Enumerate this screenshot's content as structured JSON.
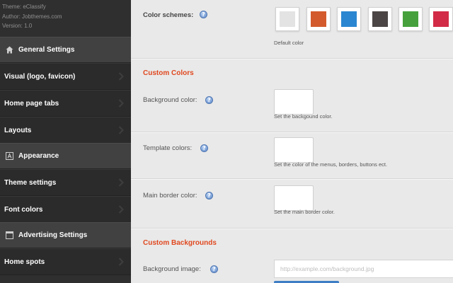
{
  "sidebar": {
    "meta": {
      "theme": "Theme: eClassify",
      "author": "Author: Jobthemes.com",
      "version": "Version: 1.0"
    },
    "sections": [
      {
        "title": "General Settings",
        "icon": "home-icon"
      },
      {
        "title": "Appearance",
        "icon": "appearance-icon"
      },
      {
        "title": "Advertising Settings",
        "icon": "window-icon"
      }
    ],
    "items": [
      {
        "label": "Visual (logo, favicon)"
      },
      {
        "label": "Home page tabs"
      },
      {
        "label": "Layouts"
      },
      {
        "label": "Theme settings"
      },
      {
        "label": "Font colors"
      },
      {
        "label": "Home spots"
      }
    ]
  },
  "main": {
    "color_schemes": {
      "label": "Color schemes:",
      "default_label": "Default color",
      "swatches": [
        "#e3e3e3",
        "#d35a2d",
        "#2a86d1",
        "#4b4645",
        "#46a13c",
        "#d22b47"
      ]
    },
    "custom_colors": {
      "title": "Custom Colors",
      "background": {
        "label": "Background color:",
        "note": "Set the backgound color."
      },
      "template": {
        "label": "Template colors:",
        "note": "Set the color of the menus, borders, buttons ect."
      },
      "border": {
        "label": "Main border color:",
        "note": "Set the main border color."
      }
    },
    "custom_backgrounds": {
      "title": "Custom Backgrounds",
      "image_label": "Background image:",
      "image_placeholder": "http://example.com/background.jpg"
    },
    "help_glyph": "?"
  }
}
